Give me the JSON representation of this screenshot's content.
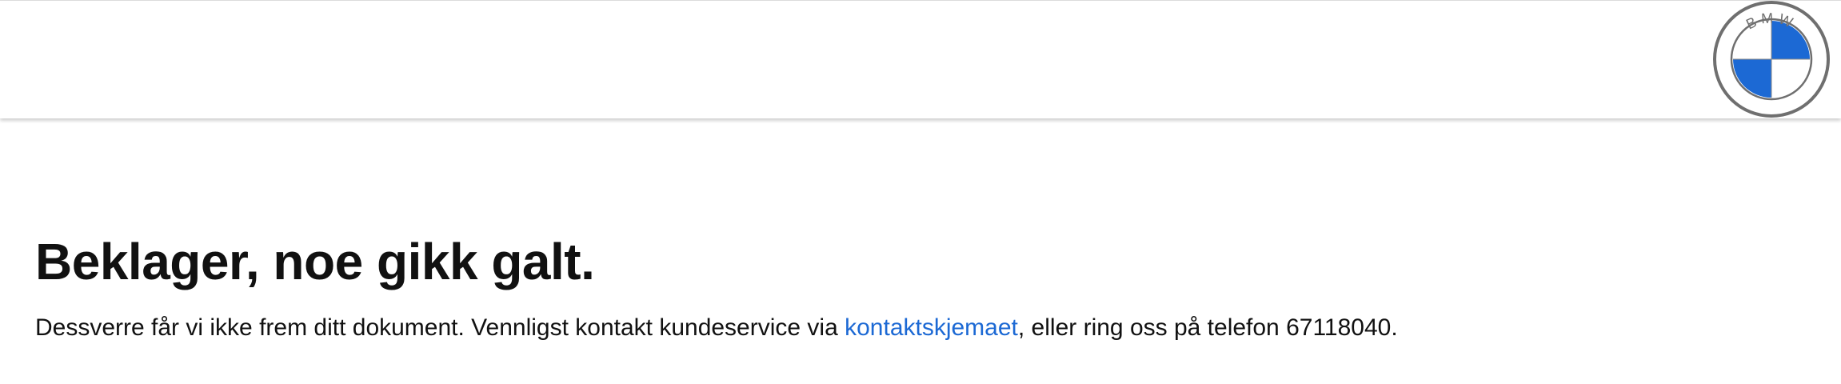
{
  "header": {
    "logo": {
      "icon": "bmw-logo-icon",
      "letters": "BMW",
      "colors": {
        "blue": "#1c69d4",
        "white": "#ffffff",
        "ring": "#6f6f6f"
      }
    }
  },
  "error": {
    "title": "Beklager, noe gikk galt.",
    "message_before": "Dessverre får vi ikke frem ditt dokument. Vennligst kontakt kundeservice via ",
    "link_text": "kontaktskjemaet",
    "message_after": ", eller ring oss på telefon 67118040."
  },
  "colors": {
    "link": "#1c69d4",
    "text": "#111111"
  }
}
